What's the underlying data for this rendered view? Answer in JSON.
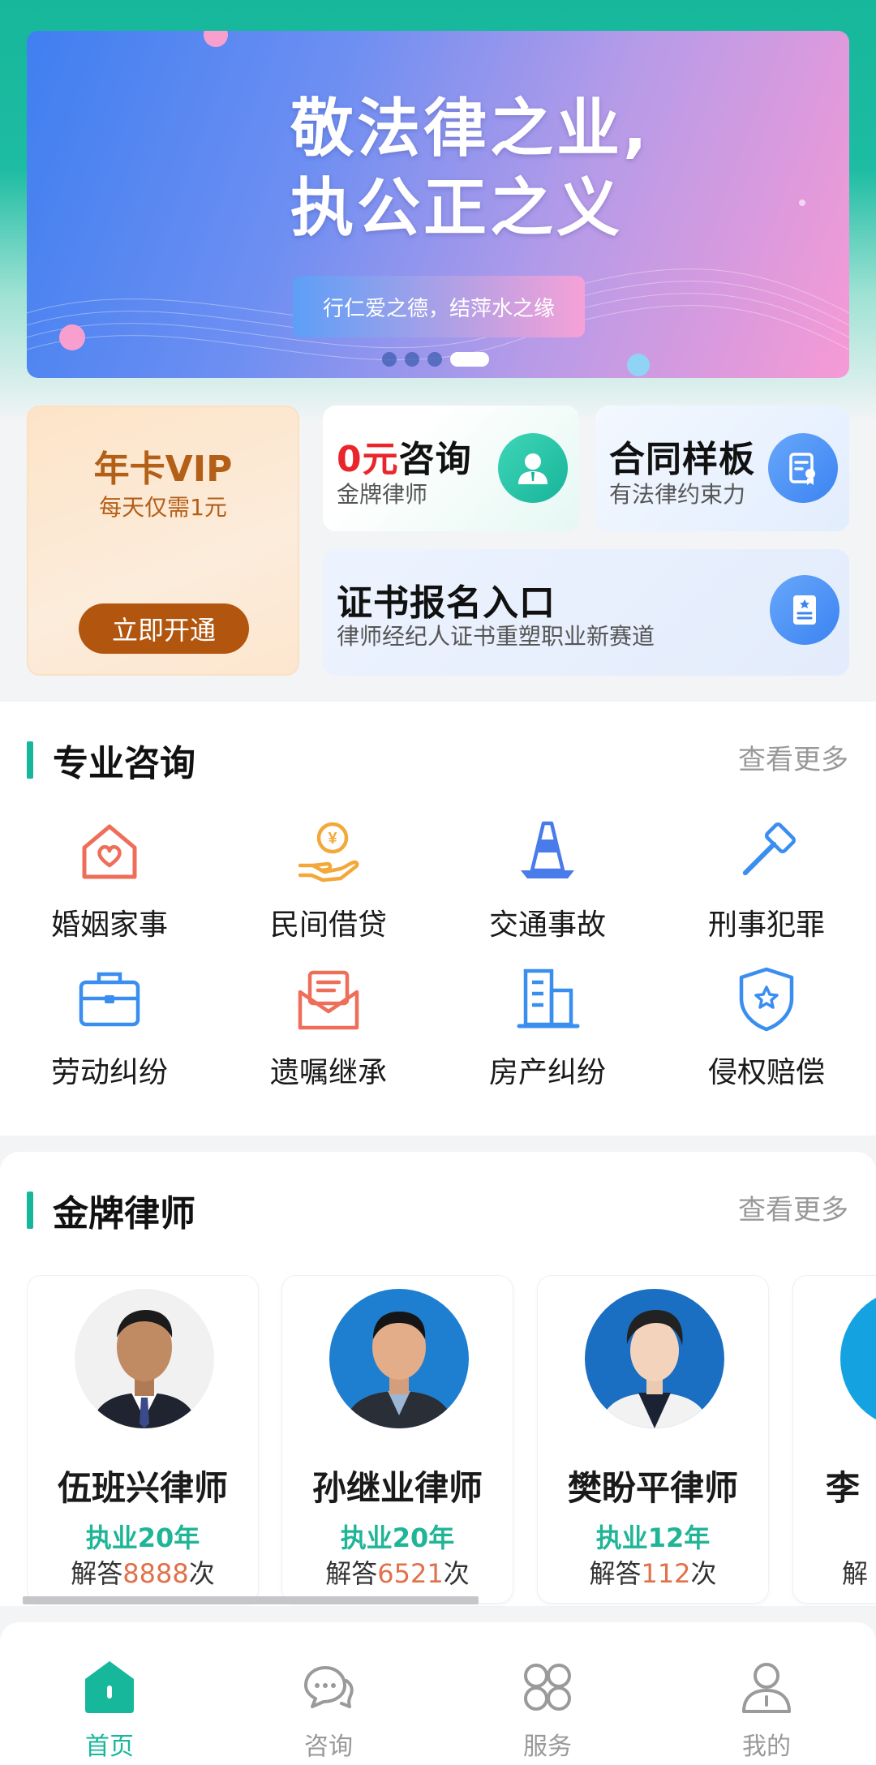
{
  "banner": {
    "title_line1": "敬法律之业,",
    "title_line2": "执公正之义",
    "subtitle": "行仁爱之德，结萍水之缘",
    "slide_count": 4,
    "active_slide": 4
  },
  "vip_card": {
    "title": "年卡VIP",
    "subtitle": "每天仅需1元",
    "button": "立即开通"
  },
  "consult_card": {
    "title_highlight": "0元",
    "title_rest": "咨询",
    "subtitle": "金牌律师",
    "icon": "lawyer-avatar-icon"
  },
  "contract_card": {
    "title": "合同样板",
    "subtitle": "有法律约束力",
    "icon": "contract-document-icon"
  },
  "cert_card": {
    "title": "证书报名入口",
    "subtitle": "律师经纪人证书重塑职业新赛道",
    "icon": "certificate-icon"
  },
  "professional": {
    "title": "专业咨询",
    "more": "查看更多",
    "categories": [
      {
        "label": "婚姻家事",
        "icon": "house-heart-icon",
        "color": "#ee6e59"
      },
      {
        "label": "民间借贷",
        "icon": "coin-hand-icon",
        "color": "#f3a93a"
      },
      {
        "label": "交通事故",
        "icon": "traffic-cone-icon",
        "color": "#4a7bea"
      },
      {
        "label": "刑事犯罪",
        "icon": "gavel-icon",
        "color": "#3a8ef0"
      },
      {
        "label": "劳动纠纷",
        "icon": "briefcase-icon",
        "color": "#3a8ef0"
      },
      {
        "label": "遗嘱继承",
        "icon": "mail-document-icon",
        "color": "#ee6e59"
      },
      {
        "label": "房产纠纷",
        "icon": "building-icon",
        "color": "#3a8ef0"
      },
      {
        "label": "侵权赔偿",
        "icon": "shield-star-icon",
        "color": "#3a8ef0"
      }
    ]
  },
  "gold_lawyers": {
    "title": "金牌律师",
    "more": "查看更多",
    "lawyers": [
      {
        "name": "伍班兴律师",
        "years": "执业20年",
        "ans_prefix": "解答",
        "ans_count": "8888",
        "ans_suffix": "次"
      },
      {
        "name": "孙继业律师",
        "years": "执业20年",
        "ans_prefix": "解答",
        "ans_count": "6521",
        "ans_suffix": "次"
      },
      {
        "name": "樊盼平律师",
        "years": "执业12年",
        "ans_prefix": "解答",
        "ans_count": "112",
        "ans_suffix": "次"
      },
      {
        "name": "李",
        "years": "",
        "ans_prefix": "解",
        "ans_count": "",
        "ans_suffix": ""
      }
    ]
  },
  "nav": {
    "items": [
      {
        "label": "首页",
        "icon": "home-icon",
        "active": true
      },
      {
        "label": "咨询",
        "icon": "chat-bubbles-icon",
        "active": false
      },
      {
        "label": "服务",
        "icon": "grid-services-icon",
        "active": false
      },
      {
        "label": "我的",
        "icon": "user-profile-icon",
        "active": false
      }
    ]
  },
  "colors": {
    "brand": "#17b79b",
    "vip_text": "#b45f17",
    "highlight_red": "#e8262c",
    "answer_count": "#e0714a"
  }
}
